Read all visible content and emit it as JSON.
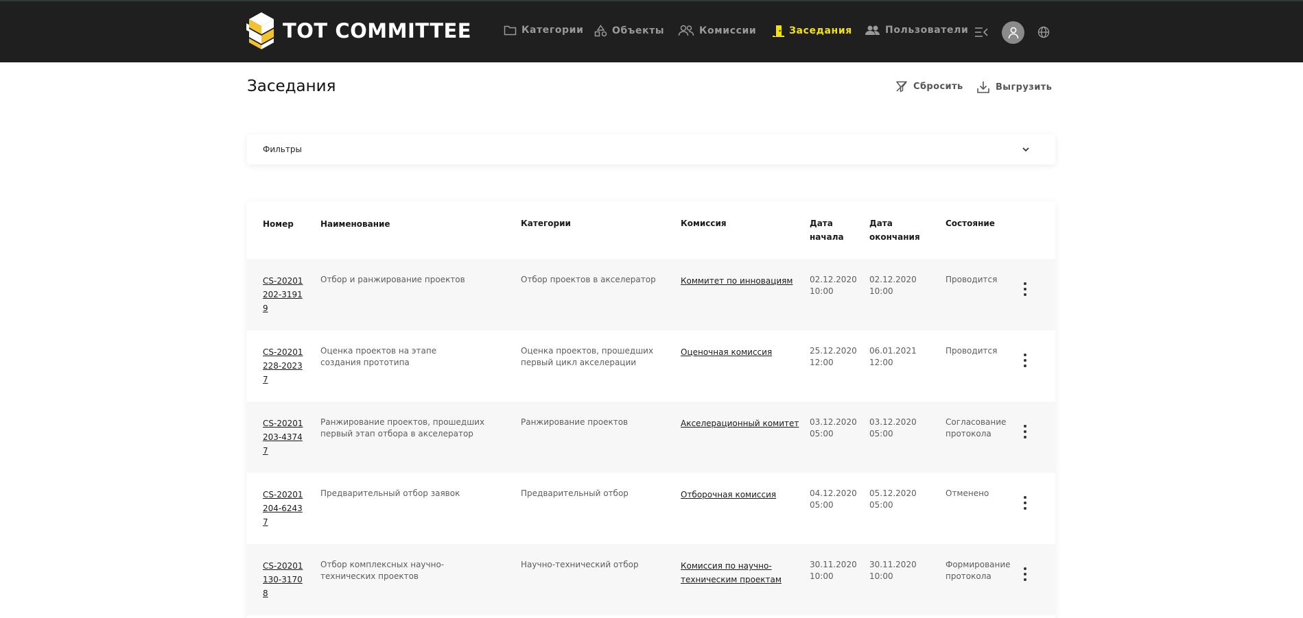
{
  "app": {
    "brand": "TOT COMMITTEE"
  },
  "nav": {
    "items": [
      {
        "label": "Категории",
        "icon": "folder-icon",
        "active": false
      },
      {
        "label": "Объекты",
        "icon": "shapes-icon",
        "active": false
      },
      {
        "label": "Комиссии",
        "icon": "users-icon",
        "active": false
      },
      {
        "label": "Заседания",
        "icon": "door-icon",
        "active": true
      },
      {
        "label": "Пользователи",
        "icon": "group-icon",
        "active": false
      }
    ],
    "accent_color": "#f5e400"
  },
  "page": {
    "title": "Заседания",
    "reset_label": "Сбросить",
    "export_label": "Выгрузить"
  },
  "filters": {
    "label": "Фильтры"
  },
  "table": {
    "headers": {
      "number": "Номер",
      "name": "Наименование",
      "categories": "Категории",
      "commission": "Комиссия",
      "start_date": "Дата начала",
      "end_date": "Дата окончания",
      "status": "Состояние"
    },
    "rows": [
      {
        "number": "CS-20201202-31919",
        "name": "Отбор и ранжирование проектов",
        "category": "Отбор проектов в акселератор",
        "commission": "Коммитет по инновациям",
        "start": "02.12.2020 10:00",
        "end": "02.12.2020 10:00",
        "status": "Проводится"
      },
      {
        "number": "CS-20201228-20237",
        "name": "Оценка проектов на этапе создания прототипа",
        "category": "Оценка проектов, прошедших первый цикл акселерации",
        "commission": "Оценочная комиссия",
        "start": "25.12.2020 12:00",
        "end": "06.01.2021 12:00",
        "status": "Проводится"
      },
      {
        "number": "CS-20201203-43747",
        "name": "Ранжирование проектов, прошедших первый этап отбора в акселератор",
        "category": "Ранжирование проектов",
        "commission": "Акселерационный комитет",
        "start": "03.12.2020 05:00",
        "end": "03.12.2020 05:00",
        "status": "Согласование протокола"
      },
      {
        "number": "CS-20201204-62437",
        "name": "Предварительный отбор заявок",
        "category": "Предварительный отбор",
        "commission": "Отборочная комиссия",
        "start": "04.12.2020 05:00",
        "end": "05.12.2020 05:00",
        "status": "Отменено"
      },
      {
        "number": "CS-20201130-31708",
        "name": "Отбор комплексных научно-технических проектов",
        "category": "Научно-технический отбор",
        "commission": "Комиссия по научно-техническим проектам",
        "start": "30.11.2020 10:00",
        "end": "30.11.2020 10:00",
        "status": "Формирование протокола"
      }
    ]
  }
}
